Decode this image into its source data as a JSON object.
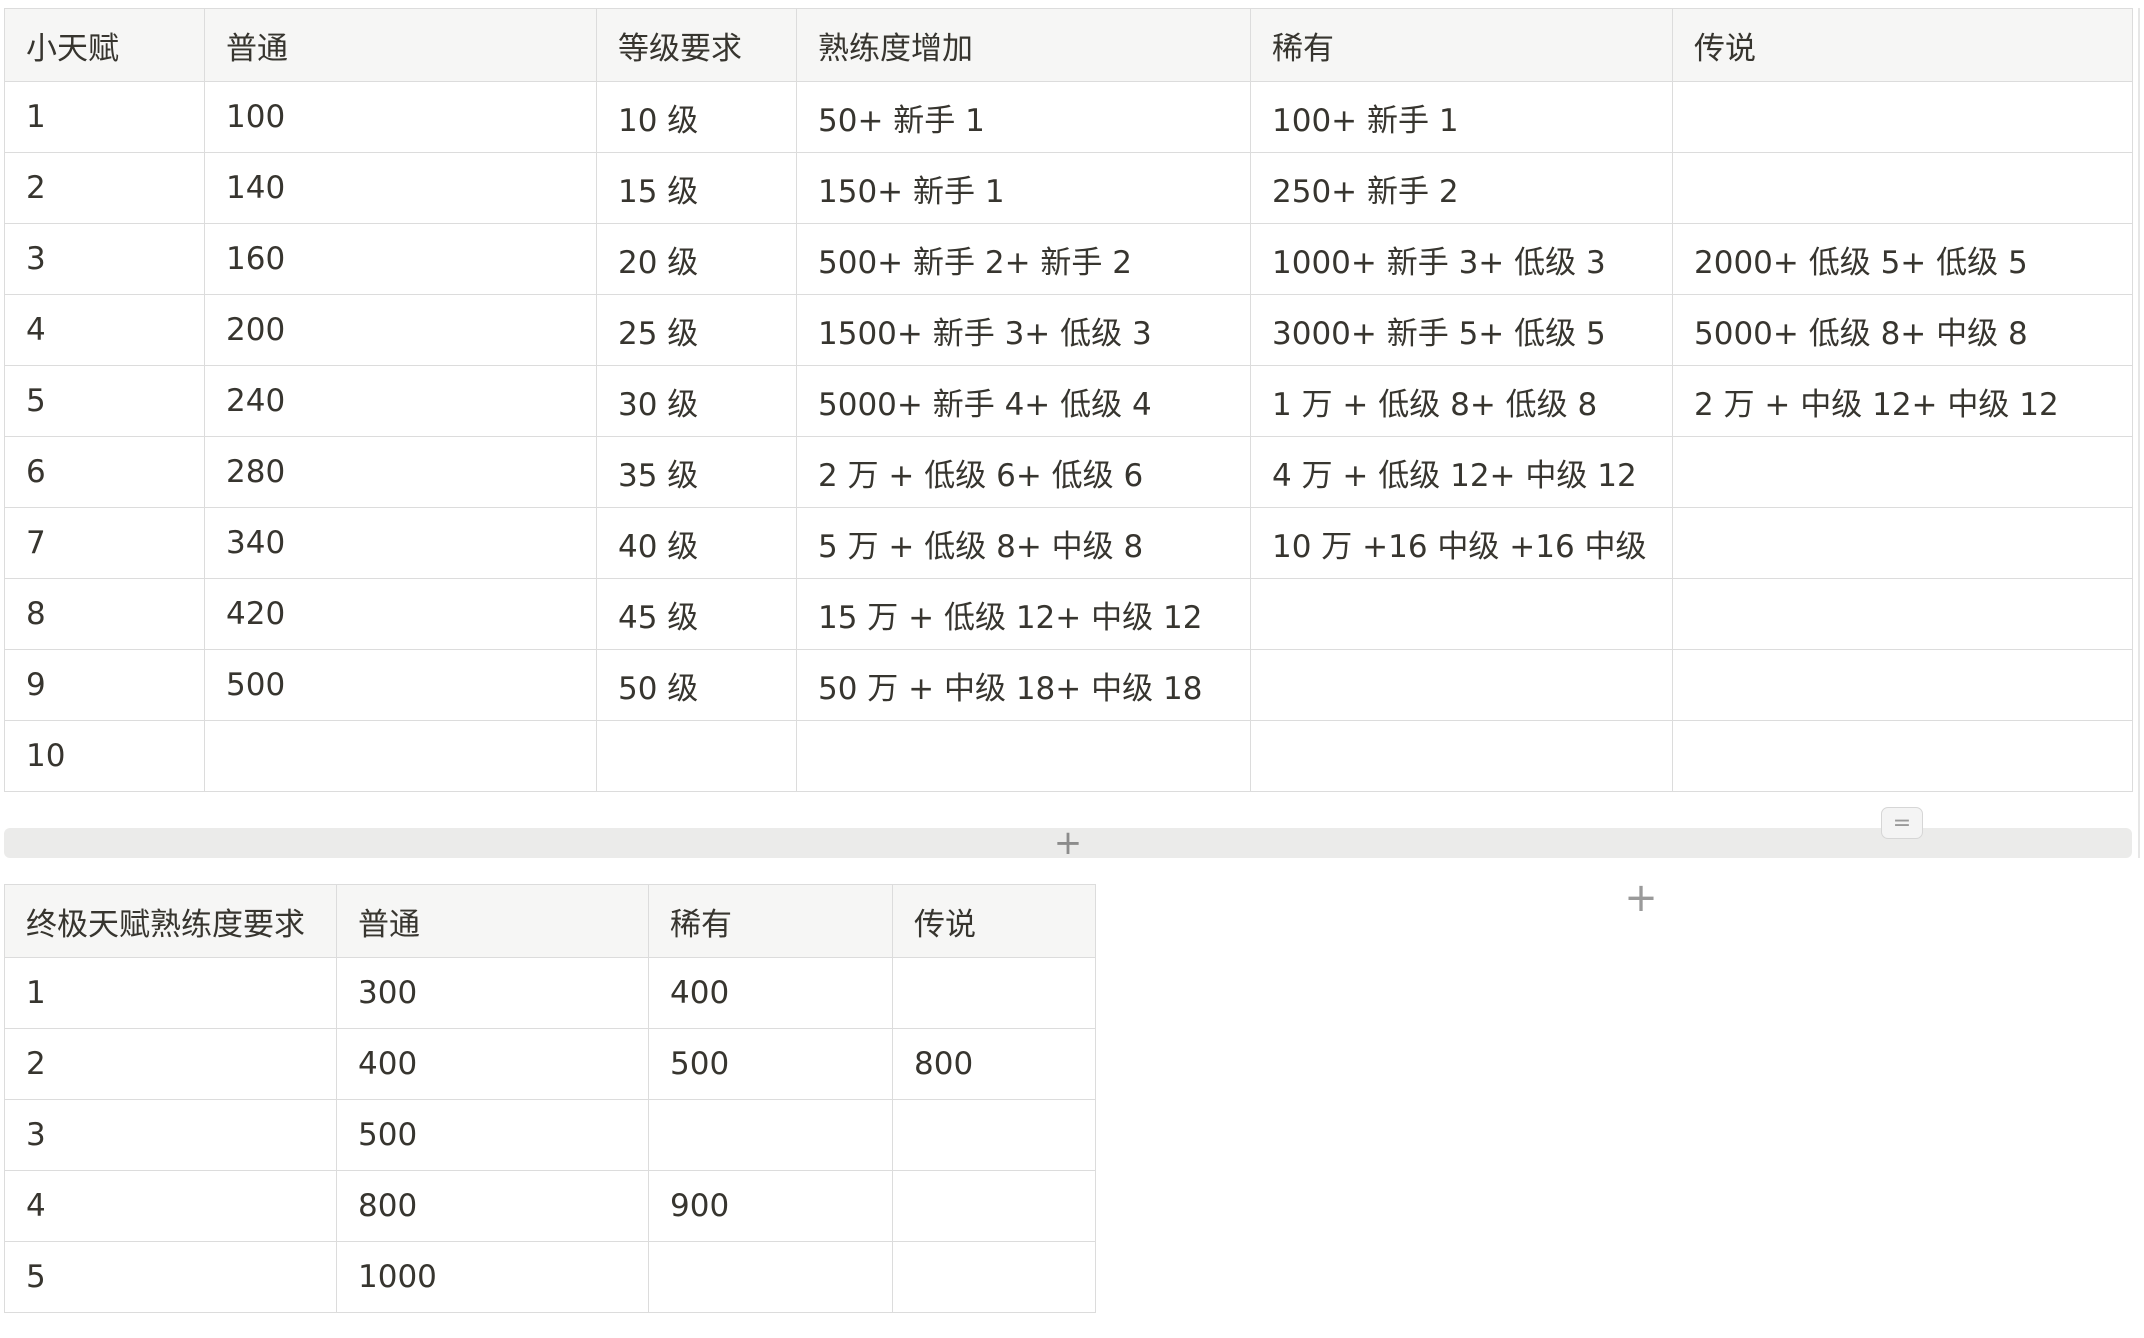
{
  "talent_table": {
    "headers": [
      "小天赋",
      "普通",
      "等级要求",
      "熟练度增加",
      "稀有",
      "传说"
    ],
    "rows": [
      [
        "1",
        "100",
        "10 级",
        "50+ 新手 1",
        "100+ 新手 1",
        ""
      ],
      [
        "2",
        "140",
        "15 级",
        "150+ 新手 1",
        "250+ 新手 2",
        ""
      ],
      [
        "3",
        "160",
        "20 级",
        "500+ 新手 2+ 新手 2",
        "1000+ 新手 3+ 低级 3",
        "2000+ 低级 5+ 低级 5"
      ],
      [
        "4",
        "200",
        "25 级",
        "1500+ 新手 3+ 低级 3",
        "3000+ 新手 5+ 低级 5",
        "5000+ 低级 8+ 中级 8"
      ],
      [
        "5",
        "240",
        "30 级",
        "5000+ 新手 4+ 低级 4",
        "1 万 + 低级 8+ 低级 8",
        "2 万 + 中级 12+ 中级 12"
      ],
      [
        "6",
        "280",
        "35 级",
        "2 万 + 低级 6+ 低级 6",
        "4 万 + 低级 12+ 中级 12",
        ""
      ],
      [
        "7",
        "340",
        "40 级",
        "5 万 + 低级 8+ 中级 8",
        "10 万 +16 中级 +16 中级",
        ""
      ],
      [
        "8",
        "420",
        "45 级",
        "15 万 + 低级 12+ 中级 12",
        "",
        ""
      ],
      [
        "9",
        "500",
        "50 级",
        "50 万 + 中级 18+ 中级 18",
        "",
        ""
      ],
      [
        "10",
        "",
        "",
        "",
        "",
        ""
      ]
    ]
  },
  "ultimate_table": {
    "headers": [
      "终极天赋熟练度要求",
      "普通",
      "稀有",
      "传说"
    ],
    "rows": [
      [
        "1",
        "300",
        "400",
        ""
      ],
      [
        "2",
        "400",
        "500",
        "800"
      ],
      [
        "3",
        "500",
        "",
        ""
      ],
      [
        "4",
        "800",
        "900",
        ""
      ],
      [
        "5",
        "1000",
        "",
        ""
      ]
    ]
  },
  "controls": {
    "add_row_symbol": "+",
    "add_column_symbol": "+",
    "resize_handle_symbol": "="
  },
  "colors": {
    "header_bg": "#f6f6f5",
    "border": "#dcdcdc",
    "text": "#37352f",
    "add_bar_bg": "#ebebea"
  }
}
